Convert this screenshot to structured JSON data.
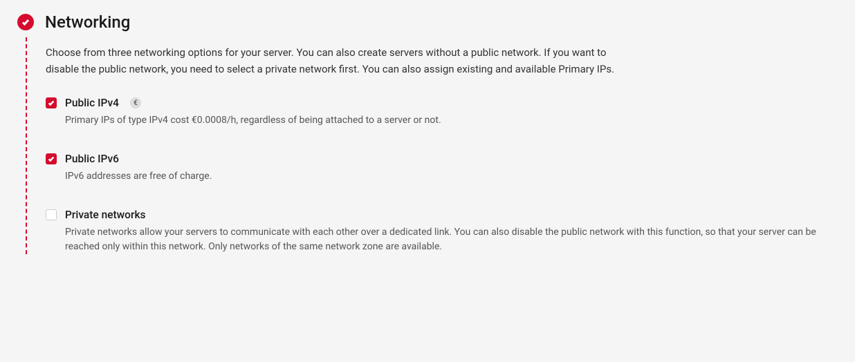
{
  "section": {
    "title": "Networking",
    "description": "Choose from three networking options for your server. You can also create servers without a public network. If you want to disable the public network, you need to select a private network first. You can also assign existing and available Primary IPs."
  },
  "options": {
    "ipv4": {
      "label": "Public IPv4",
      "badge": "€",
      "description": "Primary IPs of type IPv4 cost €0.0008/h, regardless of being attached to a server or not.",
      "checked": true
    },
    "ipv6": {
      "label": "Public IPv6",
      "description": "IPv6 addresses are free of charge.",
      "checked": true
    },
    "private": {
      "label": "Private networks",
      "description": "Private networks allow your servers to communicate with each other over a dedicated link. You can also disable the public network with this function, so that your server can be reached only within this network. Only networks of the same network zone are available.",
      "checked": false
    }
  }
}
